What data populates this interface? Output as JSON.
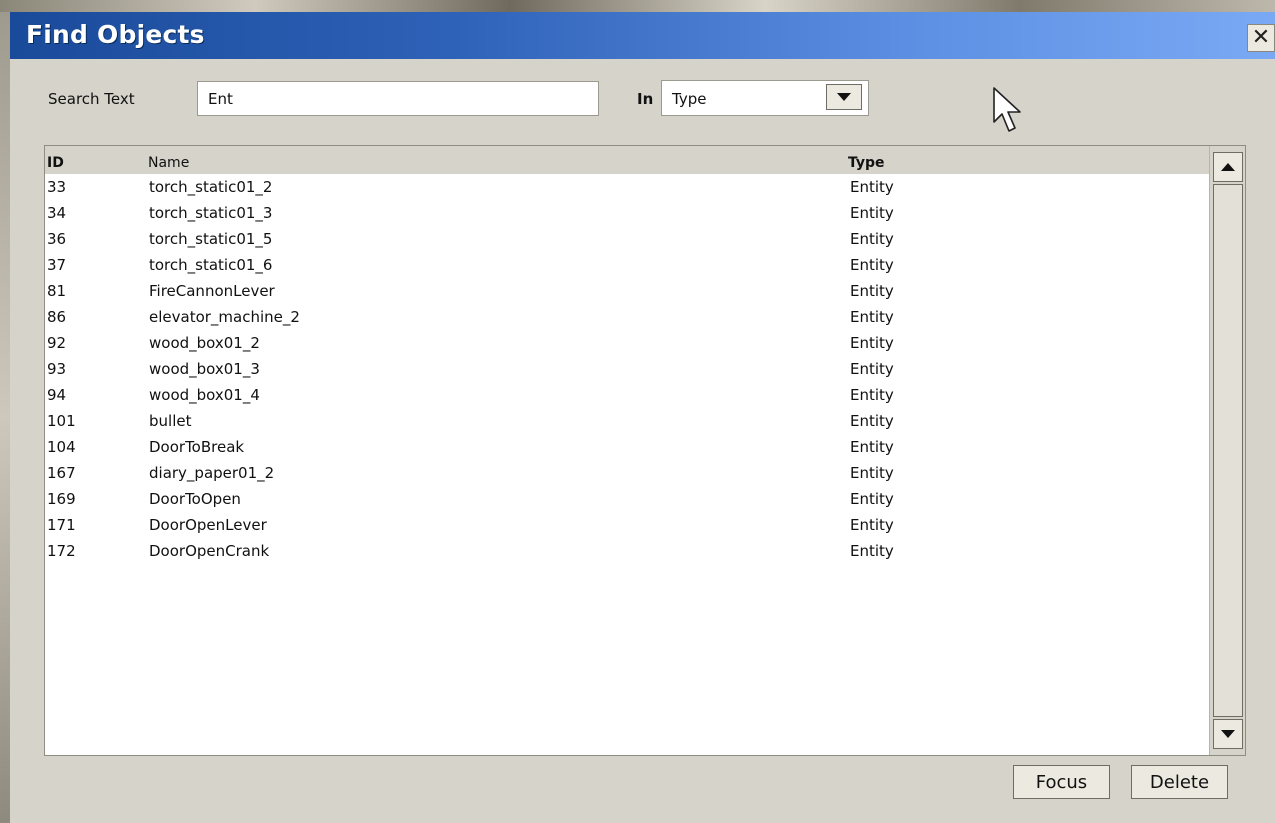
{
  "window": {
    "title": "Find Objects",
    "close_glyph": "✕"
  },
  "search": {
    "label": "Search Text",
    "value": "Ent",
    "in_label": "In",
    "field_selected": "Type"
  },
  "table": {
    "columns": [
      "ID",
      "Name",
      "Type"
    ],
    "rows": [
      [
        "33",
        "torch_static01_2",
        "Entity"
      ],
      [
        "34",
        "torch_static01_3",
        "Entity"
      ],
      [
        "36",
        "torch_static01_5",
        "Entity"
      ],
      [
        "37",
        "torch_static01_6",
        "Entity"
      ],
      [
        "81",
        "FireCannonLever",
        "Entity"
      ],
      [
        "86",
        "elevator_machine_2",
        "Entity"
      ],
      [
        "92",
        "wood_box01_2",
        "Entity"
      ],
      [
        "93",
        "wood_box01_3",
        "Entity"
      ],
      [
        "94",
        "wood_box01_4",
        "Entity"
      ],
      [
        "101",
        "bullet",
        "Entity"
      ],
      [
        "104",
        "DoorToBreak",
        "Entity"
      ],
      [
        "167",
        "diary_paper01_2",
        "Entity"
      ],
      [
        "169",
        "DoorToOpen",
        "Entity"
      ],
      [
        "171",
        "DoorOpenLever",
        "Entity"
      ],
      [
        "172",
        "DoorOpenCrank",
        "Entity"
      ]
    ]
  },
  "buttons": {
    "focus": "Focus",
    "delete": "Delete"
  },
  "icons": {
    "close": "close-icon",
    "dropdown": "chevron-down-icon",
    "scroll_up": "arrow-up-icon",
    "scroll_down": "arrow-down-icon",
    "cursor": "mouse-pointer-icon"
  },
  "colors": {
    "titlebar_start": "#1a4a9a",
    "titlebar_end": "#7aa9f4",
    "dialog_bg": "#d6d3ca",
    "list_bg": "#ffffff"
  }
}
